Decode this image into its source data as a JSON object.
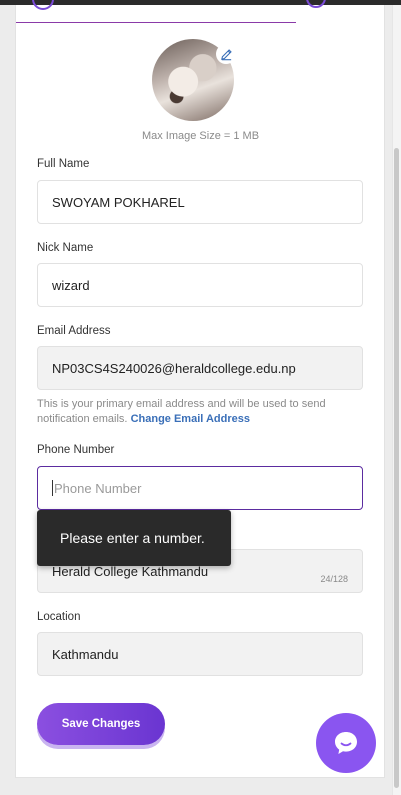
{
  "profile": {
    "max_image_size": "Max Image Size = 1 MB",
    "avatar_icon": "cat-photo",
    "edit_icon": "pencil-icon"
  },
  "form": {
    "full_name": {
      "label": "Full Name",
      "value": "SWOYAM POKHAREL"
    },
    "nick_name": {
      "label": "Nick Name",
      "value": "wizard"
    },
    "email": {
      "label": "Email Address",
      "value": "NP03CS4S240026@heraldcollege.edu.np",
      "help_text": "This is your primary email address and will be used to send notification emails.",
      "change_link": "Change Email Address"
    },
    "phone": {
      "label": "Phone Number",
      "placeholder": "Phone Number"
    },
    "college": {
      "value": "Herald College Kathmandu",
      "counter": "24/128"
    },
    "location": {
      "label": "Location",
      "value": "Kathmandu"
    }
  },
  "tooltip": {
    "text": "Please enter a number."
  },
  "actions": {
    "save_label": "Save Changes"
  },
  "colors": {
    "accent": "#7a4bd6",
    "link": "#3a6fb8",
    "focus_border": "#5b2ca0"
  }
}
